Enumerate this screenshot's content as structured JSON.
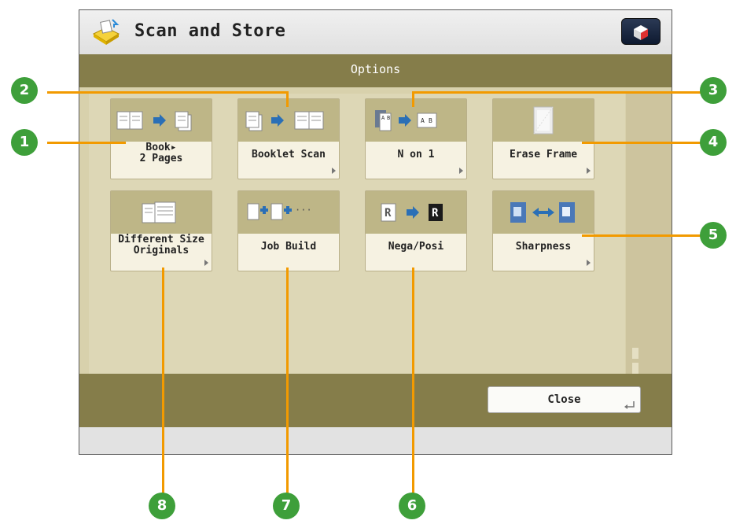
{
  "window": {
    "title": "Scan and Store",
    "bar_title": "Options"
  },
  "tiles": [
    {
      "label": "Book▸\n2 Pages",
      "icon": "book-to-pages-icon"
    },
    {
      "label": "Booklet Scan",
      "icon": "booklet-scan-icon"
    },
    {
      "label": "N on 1",
      "icon": "n-on-1-icon"
    },
    {
      "label": "Erase Frame",
      "icon": "erase-frame-icon"
    },
    {
      "label": "Different Size\nOriginals",
      "icon": "different-size-originals-icon"
    },
    {
      "label": "Job Build",
      "icon": "job-build-icon"
    },
    {
      "label": "Nega/Posi",
      "icon": "nega-posi-icon"
    },
    {
      "label": "Sharpness",
      "icon": "sharpness-icon"
    }
  ],
  "footer": {
    "close_label": "Close"
  },
  "callouts": [
    "1",
    "2",
    "3",
    "4",
    "5",
    "6",
    "7",
    "8"
  ],
  "colors": {
    "accent_bar": "#857d4a",
    "callout_badge": "#3e9f3a",
    "callout_line": "#f29a00",
    "arrow_blue": "#2a6fb6"
  }
}
